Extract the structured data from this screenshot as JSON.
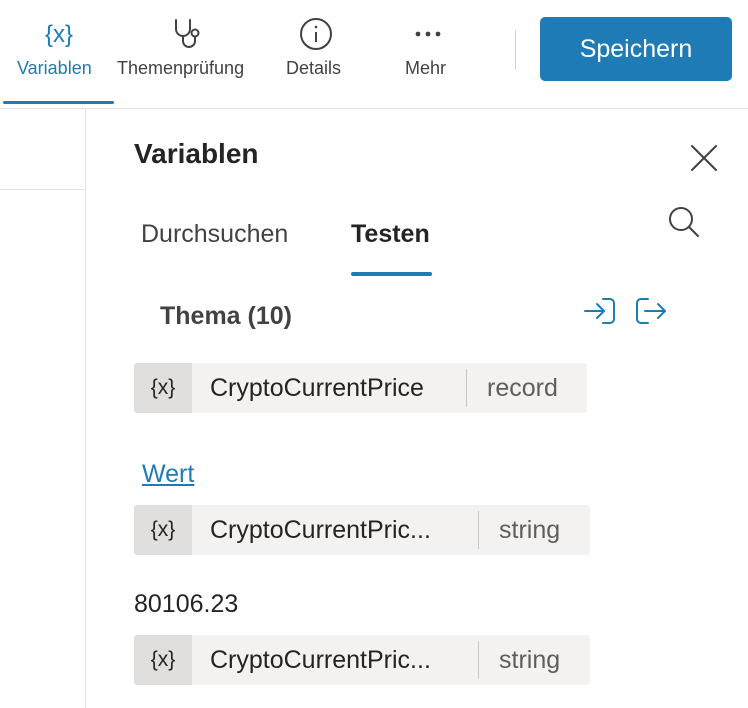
{
  "toolbar": {
    "items": [
      {
        "label": "Variablen",
        "icon": "variable-braces-icon",
        "active": true
      },
      {
        "label": "Themenprüfung",
        "icon": "stethoscope-icon",
        "active": false
      },
      {
        "label": "Details",
        "icon": "info-icon",
        "active": false
      },
      {
        "label": "Mehr",
        "icon": "more-dots-icon",
        "active": false
      }
    ],
    "save_label": "Speichern"
  },
  "panel": {
    "title": "Variablen",
    "tabs": [
      {
        "label": "Durchsuchen",
        "selected": false
      },
      {
        "label": "Testen",
        "selected": true
      }
    ],
    "section": {
      "title": "Thema (10)",
      "actions": [
        "import-icon",
        "export-icon"
      ]
    },
    "variable": {
      "icon_text": "{x}",
      "name": "CryptoCurrentPrice",
      "type": "record"
    },
    "field_link": "Wert",
    "field_variable": {
      "icon_text": "{x}",
      "name": "CryptoCurrentPric...",
      "type": "string"
    },
    "value": "80106.23",
    "next_variable": {
      "icon_text": "{x}",
      "name": "CryptoCurrentPric...",
      "type": "string"
    }
  },
  "colors": {
    "accent": "#1f7bb5",
    "chip_bg": "#f3f2f1",
    "chip_icon_bg": "#e1dfdd"
  }
}
